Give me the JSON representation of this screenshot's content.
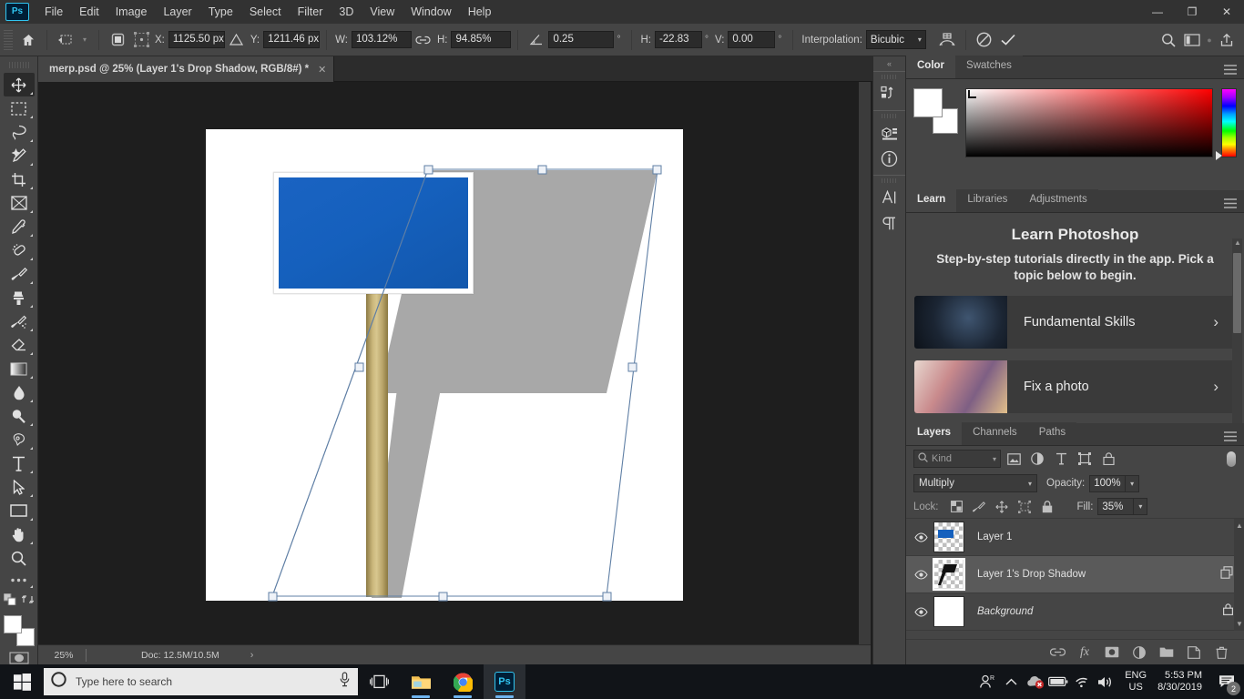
{
  "app": {
    "logo": "Ps",
    "menus": [
      "File",
      "Edit",
      "Image",
      "Layer",
      "Type",
      "Select",
      "Filter",
      "3D",
      "View",
      "Window",
      "Help"
    ],
    "window_controls": [
      "minimize-icon",
      "restore-icon",
      "close-icon"
    ]
  },
  "options_bar": {
    "home_icon": "home-icon",
    "tool_preset_icon": "move-tool-preset-icon",
    "ref_point_icon": "reference-point-icon",
    "x_label": "X:",
    "x_value": "1125.50 px",
    "delta_icon": "relative-positioning-icon",
    "y_label": "Y:",
    "y_value": "1211.46 px",
    "w_label": "W:",
    "w_value": "103.12%",
    "link_icon": "maintain-aspect-ratio-icon",
    "h_label": "H:",
    "h_value": "94.85%",
    "rotate_icon": "rotate-angle-icon",
    "rotate_value": "0.25",
    "degree": "°",
    "skew_h_label": "H:",
    "skew_h_value": "-22.83",
    "skew_v_label": "V:",
    "skew_v_value": "0.00",
    "interpolation_label": "Interpolation:",
    "interpolation_value": "Bicubic",
    "warp_icon": "warp-mode-icon",
    "cancel_icon": "cancel-transform-icon",
    "commit_icon": "commit-transform-icon",
    "search_icon": "search-icon",
    "workspace_icon": "workspace-switcher-icon",
    "share_icon": "share-icon"
  },
  "document": {
    "tab_title": "merp.psd @ 25% (Layer 1's Drop Shadow, RGB/8#) *",
    "close_icon": "close-tab-icon",
    "collapse_icon": "expand-tabs-icon"
  },
  "toolbar": {
    "tools": [
      {
        "name": "move-tool",
        "label": "Move Tool"
      },
      {
        "name": "rectangular-marquee-tool",
        "label": "Rectangular Marquee Tool"
      },
      {
        "name": "lasso-tool",
        "label": "Lasso Tool"
      },
      {
        "name": "object-selection-tool",
        "label": "Object Selection Tool"
      },
      {
        "name": "crop-tool",
        "label": "Crop Tool"
      },
      {
        "name": "frame-tool",
        "label": "Frame Tool"
      },
      {
        "name": "eyedropper-tool",
        "label": "Eyedropper Tool"
      },
      {
        "name": "spot-healing-brush-tool",
        "label": "Spot Healing Brush Tool"
      },
      {
        "name": "brush-tool",
        "label": "Brush Tool"
      },
      {
        "name": "clone-stamp-tool",
        "label": "Clone Stamp Tool"
      },
      {
        "name": "history-brush-tool",
        "label": "History Brush Tool"
      },
      {
        "name": "eraser-tool",
        "label": "Eraser Tool"
      },
      {
        "name": "gradient-tool",
        "label": "Gradient Tool"
      },
      {
        "name": "blur-tool",
        "label": "Blur Tool"
      },
      {
        "name": "dodge-tool",
        "label": "Dodge Tool"
      },
      {
        "name": "pen-tool",
        "label": "Pen Tool"
      },
      {
        "name": "horizontal-type-tool",
        "label": "Horizontal Type Tool"
      },
      {
        "name": "path-selection-tool",
        "label": "Path Selection Tool"
      },
      {
        "name": "rectangle-tool",
        "label": "Rectangle Tool"
      },
      {
        "name": "hand-tool",
        "label": "Hand Tool"
      },
      {
        "name": "zoom-tool",
        "label": "Zoom Tool"
      },
      {
        "name": "edit-toolbar-tool",
        "label": "Edit Toolbar"
      }
    ],
    "foreground_color": "#ffffff",
    "background_color": "#ffffff"
  },
  "canvas": {
    "sign_color": "#1560bd",
    "shadow_color": "#a8a8a8",
    "post_color": "#cbb77c",
    "background": "#ffffff",
    "transform_handles": 8
  },
  "status_bar": {
    "zoom": "25%",
    "doc": "Doc: 12.5M/10.5M",
    "arrow_icon": "status-expand-icon"
  },
  "icon_rail": {
    "collapse_icon": "collapse-panels-icon",
    "items": [
      {
        "name": "history-panel-icon",
        "label": "History"
      },
      {
        "name": "3d-panel-icon",
        "label": "3D"
      },
      {
        "name": "info-panel-icon",
        "label": "Info"
      },
      {
        "name": "character-panel-icon",
        "label": "Character"
      },
      {
        "name": "paragraph-panel-icon",
        "label": "Paragraph"
      }
    ]
  },
  "color_panel": {
    "tabs": [
      {
        "label": "Color",
        "active": true
      },
      {
        "label": "Swatches",
        "active": false
      }
    ],
    "menu_icon": "panel-menu-icon",
    "foreground": "#ffffff",
    "background": "#ffffff",
    "ramp_hue": "#ff0000"
  },
  "learn_panel": {
    "tabs": [
      {
        "label": "Learn",
        "active": true
      },
      {
        "label": "Libraries",
        "active": false
      },
      {
        "label": "Adjustments",
        "active": false
      }
    ],
    "menu_icon": "panel-menu-icon",
    "heading": "Learn Photoshop",
    "subheading": "Step-by-step tutorials directly in the app. Pick a topic below to begin.",
    "cards": [
      {
        "label": "Fundamental Skills",
        "chevron": "›"
      },
      {
        "label": "Fix a photo",
        "chevron": "›"
      }
    ]
  },
  "layers_panel": {
    "tabs": [
      {
        "label": "Layers",
        "active": true
      },
      {
        "label": "Channels",
        "active": false
      },
      {
        "label": "Paths",
        "active": false
      }
    ],
    "menu_icon": "panel-menu-icon",
    "filter": {
      "search_icon": "search-icon",
      "kind_label": "Kind",
      "caret": "∨",
      "icons": [
        "filter-pixel-icon",
        "filter-adjustment-icon",
        "filter-type-icon",
        "filter-shape-icon",
        "filter-smart-object-icon"
      ],
      "toggle_icon": "filter-toggle-switch"
    },
    "blend_mode": "Multiply",
    "blend_caret": "∨",
    "opacity_label": "Opacity:",
    "opacity_value": "100%",
    "lock_label": "Lock:",
    "lock_icons": [
      "lock-transparent-pixels-icon",
      "lock-image-pixels-icon",
      "lock-position-icon",
      "lock-artboard-nesting-icon",
      "lock-all-icon"
    ],
    "fill_label": "Fill:",
    "fill_value": "35%",
    "caret": "∨",
    "layers": [
      {
        "name": "Layer 1",
        "visible": true,
        "selected": false,
        "italic": false,
        "thumb": "transparent-blue-sign",
        "locked": false,
        "has_link_badge": false
      },
      {
        "name": "Layer 1's Drop Shadow",
        "visible": true,
        "selected": true,
        "italic": false,
        "thumb": "transparent-black-shadow",
        "locked": false,
        "has_link_badge": true
      },
      {
        "name": "Background",
        "visible": true,
        "selected": false,
        "italic": true,
        "thumb": "white",
        "locked": true,
        "has_link_badge": false
      }
    ],
    "footer_icons": [
      "link-layers-icon",
      "add-layer-style-icon",
      "add-layer-mask-icon",
      "new-adjustment-layer-icon",
      "new-group-icon",
      "new-layer-icon",
      "delete-layer-icon"
    ]
  },
  "taskbar": {
    "start_icon": "windows-start-icon",
    "search_icon": "cortana-circle-icon",
    "search_placeholder": "Type here to search",
    "mic_icon": "microphone-icon",
    "task_view_icon": "task-view-icon",
    "apps": [
      {
        "name": "file-explorer-icon",
        "label": "File Explorer",
        "running": true,
        "active": false
      },
      {
        "name": "google-chrome-icon",
        "label": "Google Chrome",
        "running": true,
        "active": false
      },
      {
        "name": "photoshop-icon",
        "label": "Adobe Photoshop",
        "running": true,
        "active": true
      }
    ],
    "tray": [
      {
        "name": "people-icon"
      },
      {
        "name": "show-hidden-icons-chevron"
      },
      {
        "name": "onedrive-error-icon"
      },
      {
        "name": "battery-icon"
      },
      {
        "name": "wifi-icon"
      },
      {
        "name": "volume-icon"
      }
    ],
    "language_line1": "ENG",
    "language_line2": "US",
    "time": "5:53 PM",
    "date": "8/30/2019",
    "notification_icon": "action-center-icon",
    "notification_count": "2"
  }
}
